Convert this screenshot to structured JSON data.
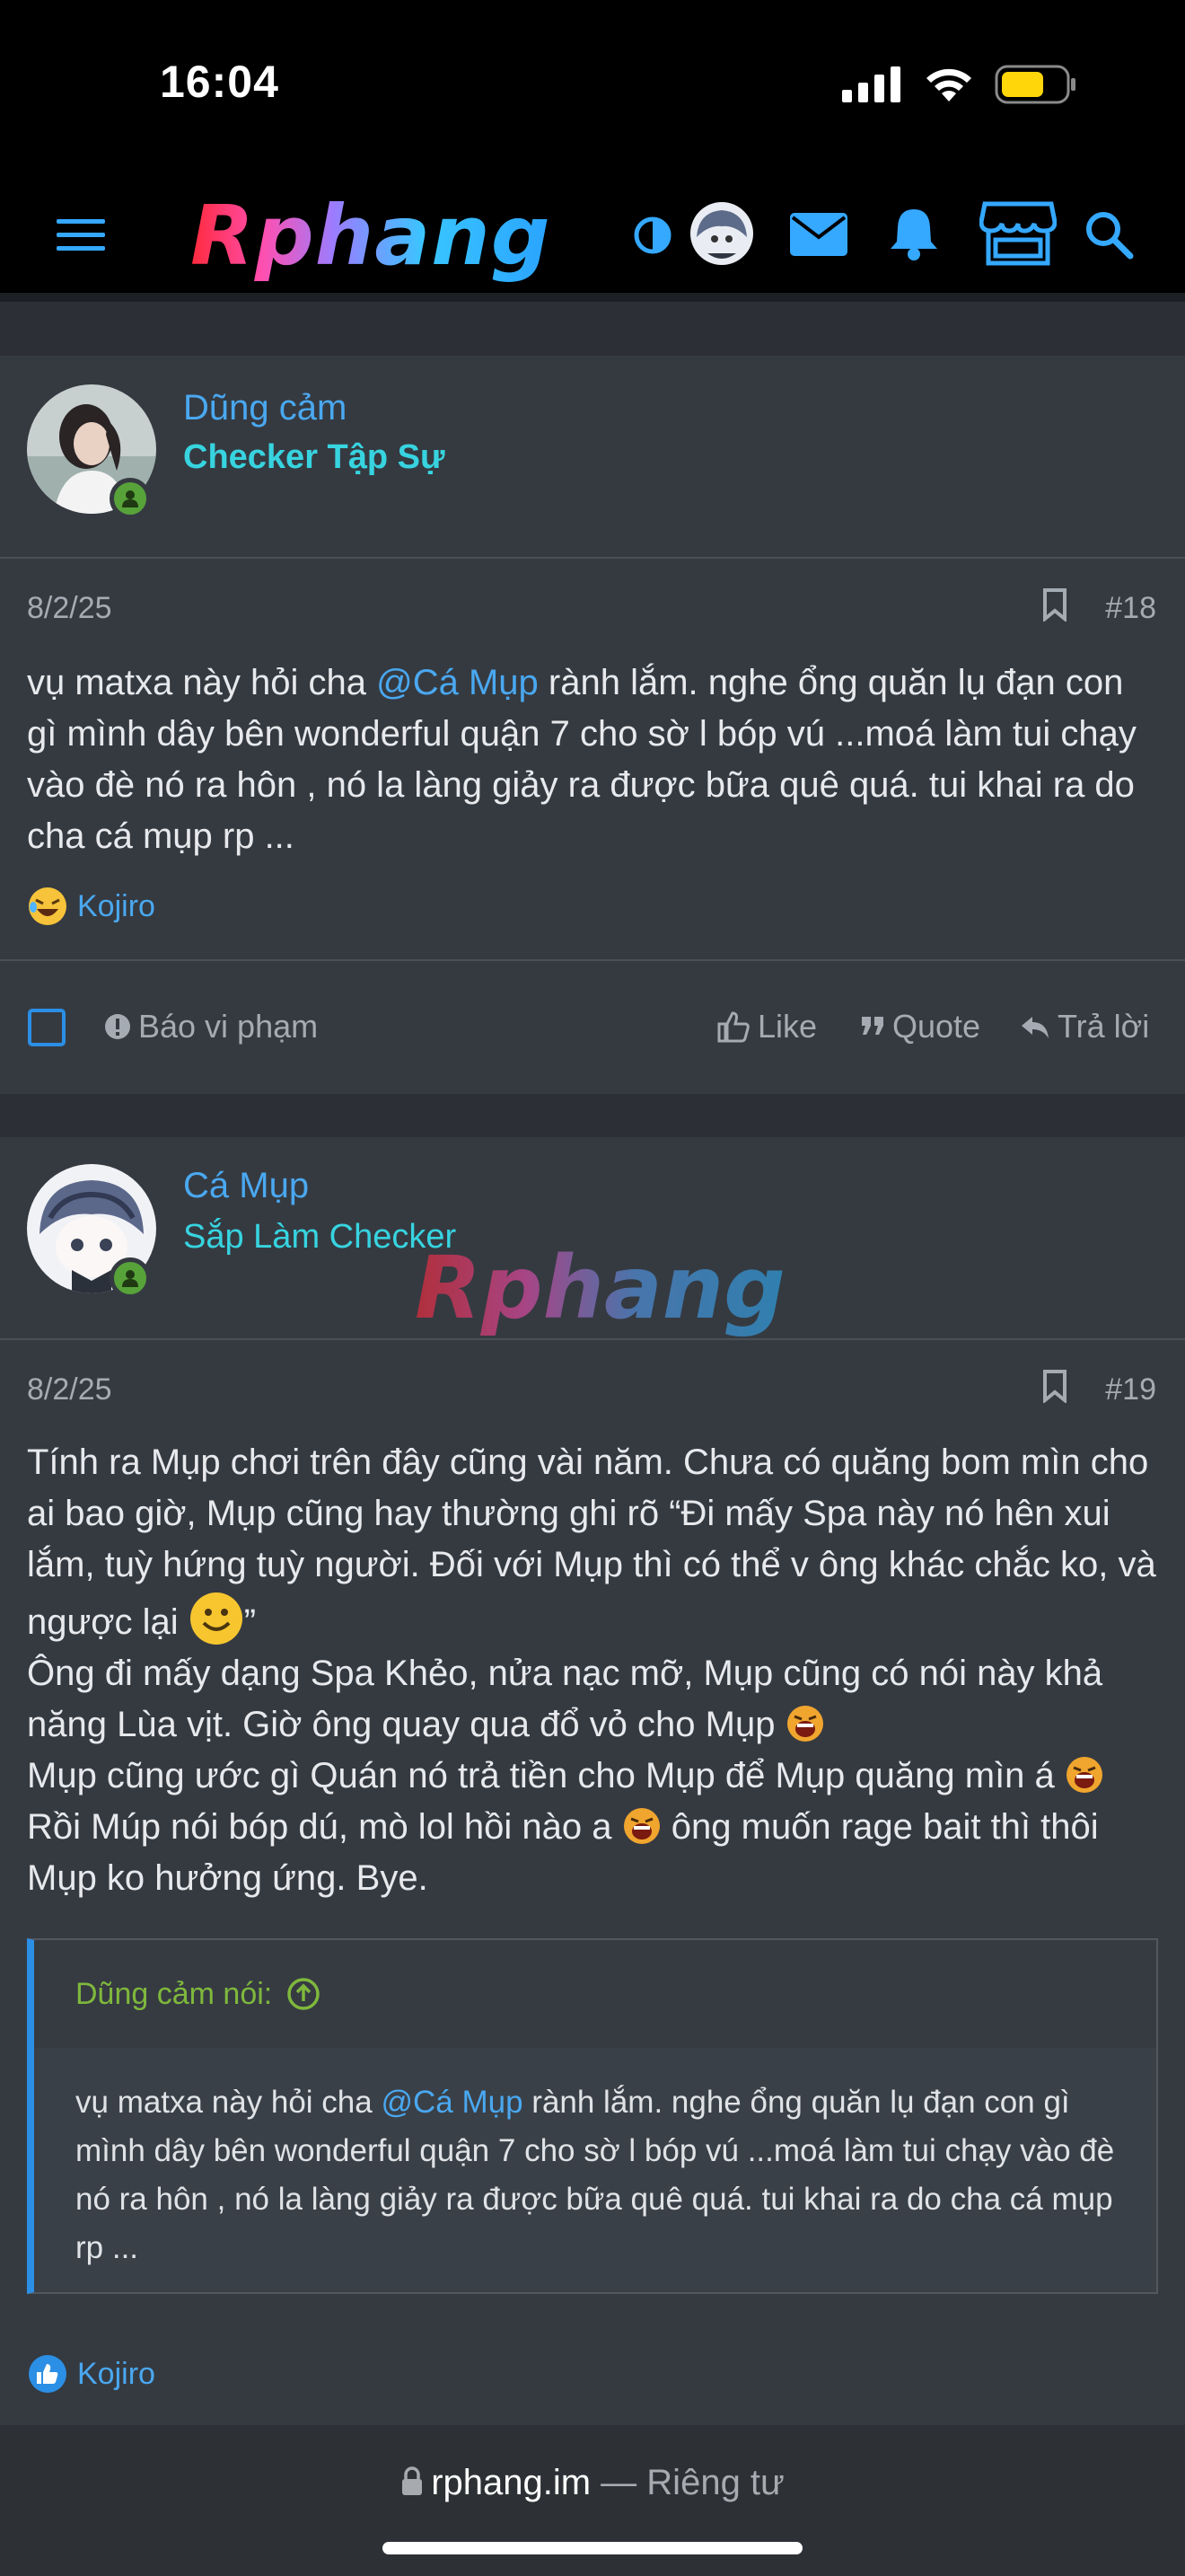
{
  "status": {
    "time": "16:04"
  },
  "nav": {
    "logo": "Rphang",
    "icons": [
      "menu-icon",
      "theme-toggle-icon",
      "avatar",
      "mail-icon",
      "bell-icon",
      "store-icon",
      "search-icon"
    ],
    "accent": "#35a8ff"
  },
  "posts": [
    {
      "username": "Dũng cảm",
      "user_title": "Checker Tập Sự",
      "title_color": "#37d4e0",
      "date": "8/2/25",
      "number": "#18",
      "body_pre": "vụ matxa này hỏi cha ",
      "mention": "@Cá Mụp",
      "body_post": " rành lắm. nghe ổng quăn lụ đạn con gì mình dây bên wonderful quận 7 cho sờ l bóp vú ...moá làm tui chạy vào đè nó ra hôn , nó la làng giảy ra được bữa quê quá. tui khai ra do cha cá mụp rp ...",
      "reaction_user": "Kojiro",
      "actions": {
        "report": "Báo vi phạm",
        "like": "Like",
        "quote": "Quote",
        "reply": "Trả lời"
      }
    },
    {
      "username": "Cá Mụp",
      "user_title": "Sắp Làm Checker",
      "title_color": "#37d4e0",
      "date": "8/2/25",
      "number": "#19",
      "line1": "Tính ra Mụp chơi trên đây cũng vài năm. Chưa có quăng bom mìn cho ai bao giờ, Mụp cũng hay thường ghi rõ “Đi mấy Spa này nó hên xui lắm, tuỳ hứng tuỳ người. Đối với Mụp thì có thể v ông khác chắc ko, và ngược lại",
      "line1_end": "”",
      "line2": "Ông đi mấy dạng Spa Khẻo, nửa nạc mỡ, Mụp cũng có nói này khả năng Lùa vịt. Giờ ông quay qua đổ vỏ cho Mụp",
      "line3": "Mụp cũng ước gì Quán nó trả tiền cho Mụp để Mụp quăng mìn á",
      "line4a": "Rồi Múp nói bóp dú, mò lol hồi nào a",
      "line4b": " ông muốn rage bait thì thôi Mụp ko hưởng ứng. Bye.",
      "quote": {
        "author": "Dũng cảm nói:",
        "body_pre": "vụ matxa này hỏi cha ",
        "mention": "@Cá Mụp",
        "body_post": " rành lắm. nghe ổng quăn lụ đạn con gì mình dây bên wonderful quận 7 cho sờ l bóp vú ...moá làm tui chạy vào đè nó ra hôn , nó la làng giảy ra được bữa quê quá. tui khai ra do cha cá mụp rp ..."
      },
      "reaction_user": "Kojiro"
    }
  ],
  "watermark": "Rphang",
  "browser": {
    "domain": "rphang.im",
    "separator": " — ",
    "privacy": "Riêng tư"
  }
}
